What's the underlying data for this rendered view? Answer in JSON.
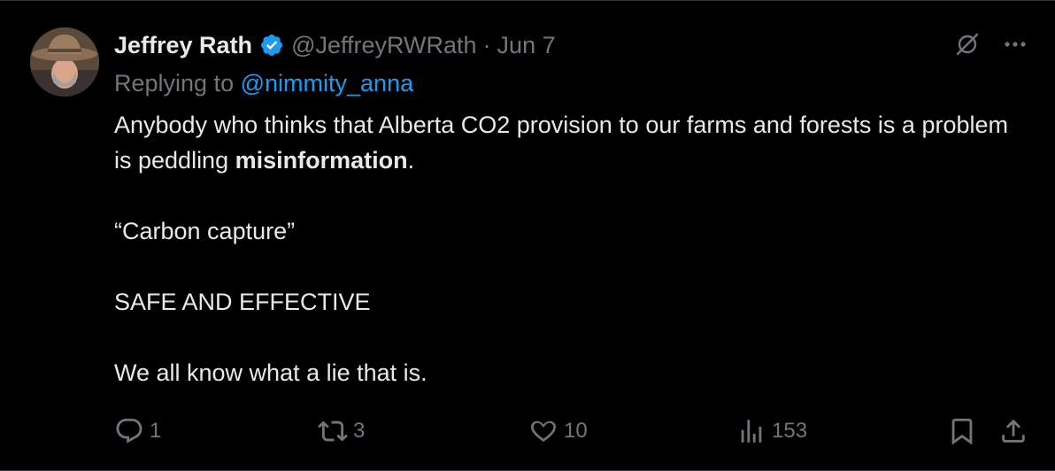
{
  "author": {
    "display_name": "Jeffrey Rath",
    "handle": "@JeffreyRWRath",
    "separator": "·",
    "date": "Jun 7",
    "avatar_icon": "cowboy-hat-avatar"
  },
  "reply": {
    "prefix": "Replying to",
    "mention": "@nimmity_anna"
  },
  "tweet_text": {
    "line1_before": "Anybody who thinks that Alberta CO2 provision to our farms and forests is a problem is peddling",
    "line1_bold": "misinformation",
    "line1_after": ".",
    "line2": "“Carbon capture”",
    "line3": "SAFE AND EFFECTIVE",
    "line4": "We all know what a lie that is."
  },
  "metrics": {
    "replies": "1",
    "reposts": "3",
    "likes": "10",
    "views": "153"
  },
  "colors": {
    "background": "#000000",
    "text": "#e7e9ea",
    "secondary": "#71767b",
    "accent": "#1d9bf0"
  },
  "icons": {
    "verified": "verified-badge-icon",
    "grok": "grok-icon",
    "more": "more-icon",
    "reply": "reply-icon",
    "repost": "repost-icon",
    "like": "heart-icon",
    "views": "views-icon",
    "bookmark": "bookmark-icon",
    "share": "share-icon"
  }
}
